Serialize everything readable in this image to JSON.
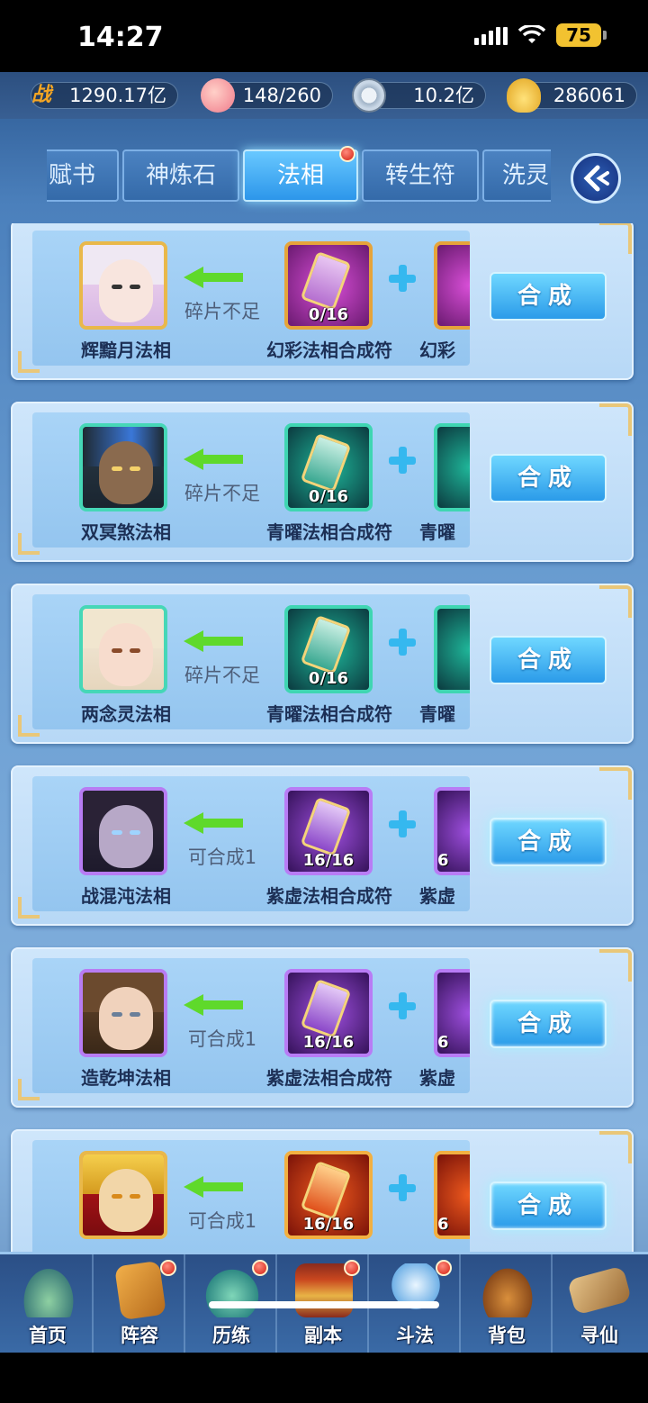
{
  "status_bar": {
    "time": "14:27",
    "battery": "75"
  },
  "resources": [
    {
      "icon": "battle-power-icon",
      "symbol": "战",
      "value": "1290.17亿",
      "color": "#f6a623"
    },
    {
      "icon": "peach-icon",
      "symbol": "",
      "value": "148/260",
      "color": "#f58ea0"
    },
    {
      "icon": "coin-icon",
      "symbol": "",
      "value": "10.2亿",
      "color": "#c9d7e6"
    },
    {
      "icon": "gold-ingot-icon",
      "symbol": "",
      "value": "286061",
      "color": "#f5c73a"
    }
  ],
  "tabs": [
    {
      "label": "赋书",
      "active": false
    },
    {
      "label": "神炼石",
      "active": false
    },
    {
      "label": "法相",
      "active": true
    },
    {
      "label": "转生符",
      "active": false
    },
    {
      "label": "洗灵",
      "active": false
    }
  ],
  "synth_label": "合成",
  "cards": [
    {
      "name": "辉黯月法相",
      "status": "碎片不足",
      "item_name": "幻彩法相合成符",
      "count": "0/16",
      "item2_name": "幻彩",
      "item2_count": "",
      "tier": "gold"
    },
    {
      "name": "双冥煞法相",
      "status": "碎片不足",
      "item_name": "青曜法相合成符",
      "count": "0/16",
      "item2_name": "青曜",
      "item2_count": "",
      "tier": "teal"
    },
    {
      "name": "两念灵法相",
      "status": "碎片不足",
      "item_name": "青曜法相合成符",
      "count": "0/16",
      "item2_name": "青曜",
      "item2_count": "",
      "tier": "teal"
    },
    {
      "name": "战混沌法相",
      "status": "可合成1",
      "item_name": "紫虚法相合成符",
      "count": "16/16",
      "item2_name": "紫虚",
      "item2_count": "6",
      "tier": "purple"
    },
    {
      "name": "造乾坤法相",
      "status": "可合成1",
      "item_name": "紫虚法相合成符",
      "count": "16/16",
      "item2_name": "紫虚",
      "item2_count": "6",
      "tier": "purple"
    },
    {
      "name": "",
      "status": "可合成1",
      "item_name": "",
      "count": "16/16",
      "item2_name": "",
      "item2_count": "6",
      "tier": "red"
    }
  ],
  "bottom_nav": [
    {
      "label": "首页",
      "icon": "home-landscape-icon",
      "badge": false
    },
    {
      "label": "阵容",
      "icon": "cards-icon",
      "badge": true
    },
    {
      "label": "历练",
      "icon": "gourd-icon",
      "badge": true
    },
    {
      "label": "副本",
      "icon": "temple-gate-icon",
      "badge": true
    },
    {
      "label": "斗法",
      "icon": "crossed-swords-icon",
      "badge": true
    },
    {
      "label": "背包",
      "icon": "bag-icon",
      "badge": false
    },
    {
      "label": "寻仙",
      "icon": "scroll-icon",
      "badge": false
    }
  ],
  "colors": {
    "accent": "#2c96ea",
    "badge_red": "#d32010",
    "frame_gold": "#e9c779"
  }
}
